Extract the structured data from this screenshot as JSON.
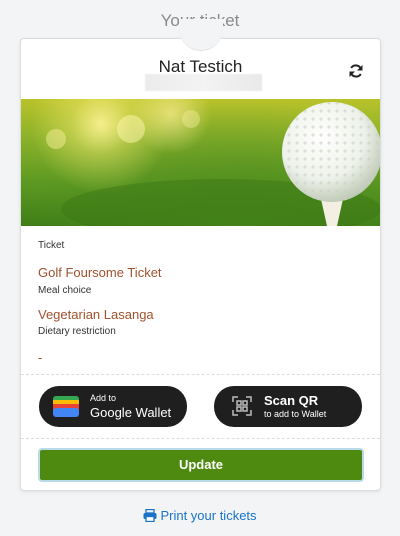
{
  "page": {
    "title": "Your ticket"
  },
  "ticket": {
    "holder_name": "Nat Testich",
    "fields": [
      {
        "label": "Ticket",
        "value": "Golf Foursome Ticket"
      },
      {
        "label": "Meal choice",
        "value": "Vegetarian Lasanga"
      },
      {
        "label": "Dietary restriction",
        "value": "-"
      }
    ]
  },
  "wallet": {
    "google": {
      "line1": "Add to",
      "line2": "Google Wallet"
    },
    "scan": {
      "line1": "Scan QR",
      "line2": "to add to Wallet"
    }
  },
  "actions": {
    "update_label": "Update",
    "print_label": "Print your tickets"
  },
  "icons": {
    "refresh": "refresh-icon",
    "print": "printer-icon",
    "wallet": "google-wallet-icon",
    "qr": "qr-scan-icon"
  },
  "colors": {
    "accent_green": "#4f8a10",
    "link_blue": "#1a73c8",
    "value_brown": "#a0522d"
  }
}
